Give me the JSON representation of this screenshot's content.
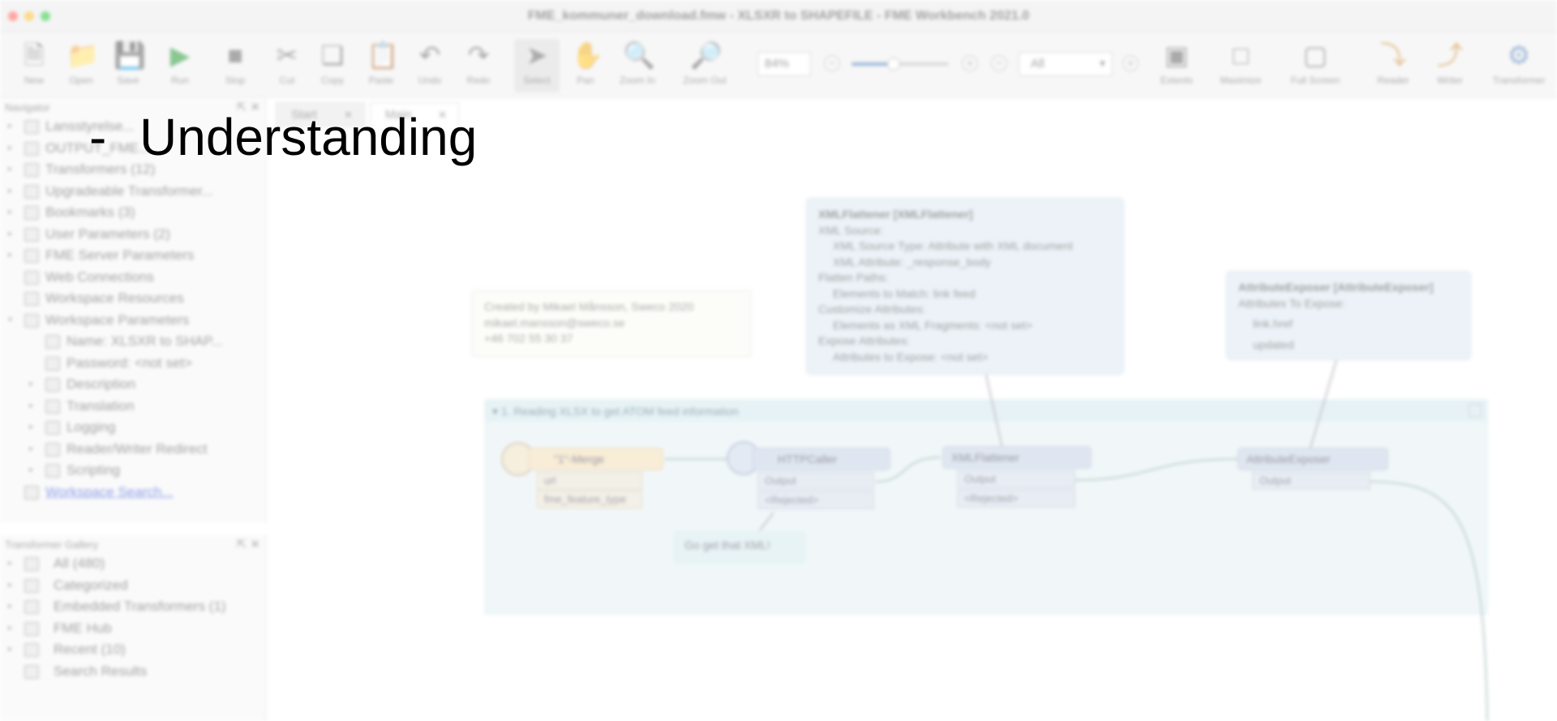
{
  "overlay": {
    "bullet": "-",
    "text": "Understanding"
  },
  "window": {
    "title": "FME_kommuner_download.fmw - XLSXR to SHAPEFILE - FME Workbench 2021.0"
  },
  "toolbar": {
    "buttons": [
      {
        "label": "New",
        "icon": "new-file-icon"
      },
      {
        "label": "Open",
        "icon": "folder-icon"
      },
      {
        "label": "Save",
        "icon": "save-icon"
      },
      {
        "label": "Run",
        "icon": "play-icon"
      },
      {
        "label": "Stop",
        "icon": "stop-icon"
      },
      {
        "label": "Cut",
        "icon": "scissors-icon"
      },
      {
        "label": "Copy",
        "icon": "copy-icon"
      },
      {
        "label": "Paste",
        "icon": "clipboard-icon"
      },
      {
        "label": "Undo",
        "icon": "undo-icon"
      },
      {
        "label": "Redo",
        "icon": "redo-icon"
      },
      {
        "label": "Select",
        "icon": "pointer-icon"
      },
      {
        "label": "Pan",
        "icon": "hand-icon"
      },
      {
        "label": "Zoom In",
        "icon": "zoom-in-icon"
      },
      {
        "label": "Zoom Out",
        "icon": "zoom-out-icon"
      },
      {
        "label": "Extents",
        "icon": "extents-icon"
      },
      {
        "label": "Maximize",
        "icon": "maximize-icon"
      },
      {
        "label": "Full Screen",
        "icon": "fullscreen-icon"
      },
      {
        "label": "Reader",
        "icon": "reader-icon"
      },
      {
        "label": "Writer",
        "icon": "writer-icon"
      },
      {
        "label": "Transformer",
        "icon": "transformer-icon"
      }
    ],
    "zoom_value": "84%",
    "zoom_level": 0.43,
    "view_select": "All"
  },
  "navigator": {
    "title": "Navigator",
    "items": [
      {
        "label": "Lansstyrelse...",
        "indent": 0
      },
      {
        "label": "OUTPUT_FME...",
        "indent": 0
      },
      {
        "label": "Transformers (12)",
        "indent": 0
      },
      {
        "label": "Upgradeable Transformer...",
        "indent": 0
      },
      {
        "label": "Bookmarks (3)",
        "indent": 0
      },
      {
        "label": "User Parameters (2)",
        "indent": 0
      },
      {
        "label": "FME Server Parameters",
        "indent": 0
      },
      {
        "label": "Web Connections",
        "indent": 0
      },
      {
        "label": "Workspace Resources",
        "indent": 0
      },
      {
        "label": "Workspace Parameters",
        "indent": 0
      },
      {
        "label": "Name: XLSXR to SHAP...",
        "indent": 1
      },
      {
        "label": "Password: <not set>",
        "indent": 1
      },
      {
        "label": "Description",
        "indent": 1
      },
      {
        "label": "Translation",
        "indent": 1
      },
      {
        "label": "Logging",
        "indent": 1
      },
      {
        "label": "Reader/Writer Redirect",
        "indent": 1
      },
      {
        "label": "Scripting",
        "indent": 1
      },
      {
        "label": "Workspace Search...",
        "indent": 0
      }
    ]
  },
  "gallery": {
    "title": "Transformer Gallery",
    "items": [
      {
        "label": "All (480)"
      },
      {
        "label": "Categorized"
      },
      {
        "label": "Embedded Transformers (1)"
      },
      {
        "label": "FME Hub"
      },
      {
        "label": "Recent (10)"
      },
      {
        "label": "Search Results"
      }
    ]
  },
  "tabs": [
    {
      "label": "Start"
    },
    {
      "label": "Main"
    }
  ],
  "canvas": {
    "note": [
      "Created by Mikael Månsson, Sweco 2020",
      "mikael.mansson@sweco.se",
      "+46 702 55 30 37"
    ],
    "xml_annot": {
      "title": "XMLFlattener [XMLFlattener]",
      "lines": [
        "XML Source:",
        "XML Source Type: Attribute with XML document",
        "XML Attribute: _response_body",
        "Flatten Paths:",
        "Elements to Match: link feed",
        "Customize Attributes:",
        "Elements as XML Fragments: <not set>",
        "Expose Attributes:",
        "Attributes to Expose: <not set>"
      ]
    },
    "expose_annot": {
      "title": "AttributeExposer [AttributeExposer]",
      "lines": [
        "Attributes To Expose:",
        "link.href",
        "updated"
      ]
    },
    "bookmark_title": "1. Reading XLSX to get ATOM feed information",
    "merge": {
      "label": "\"1\"-Merge",
      "ports": [
        "url",
        "fme_feature_type"
      ]
    },
    "httpcaller": {
      "label": "HTTPCaller",
      "ports": [
        "Output",
        "<Rejected>"
      ]
    },
    "xmlflattener": {
      "label": "XMLFlattener",
      "ports": [
        "Output",
        "<Rejected>"
      ]
    },
    "attributeexposer": {
      "label": "AttributeExposer",
      "ports": [
        "Output"
      ]
    },
    "go_note": "Go get that XML!"
  }
}
